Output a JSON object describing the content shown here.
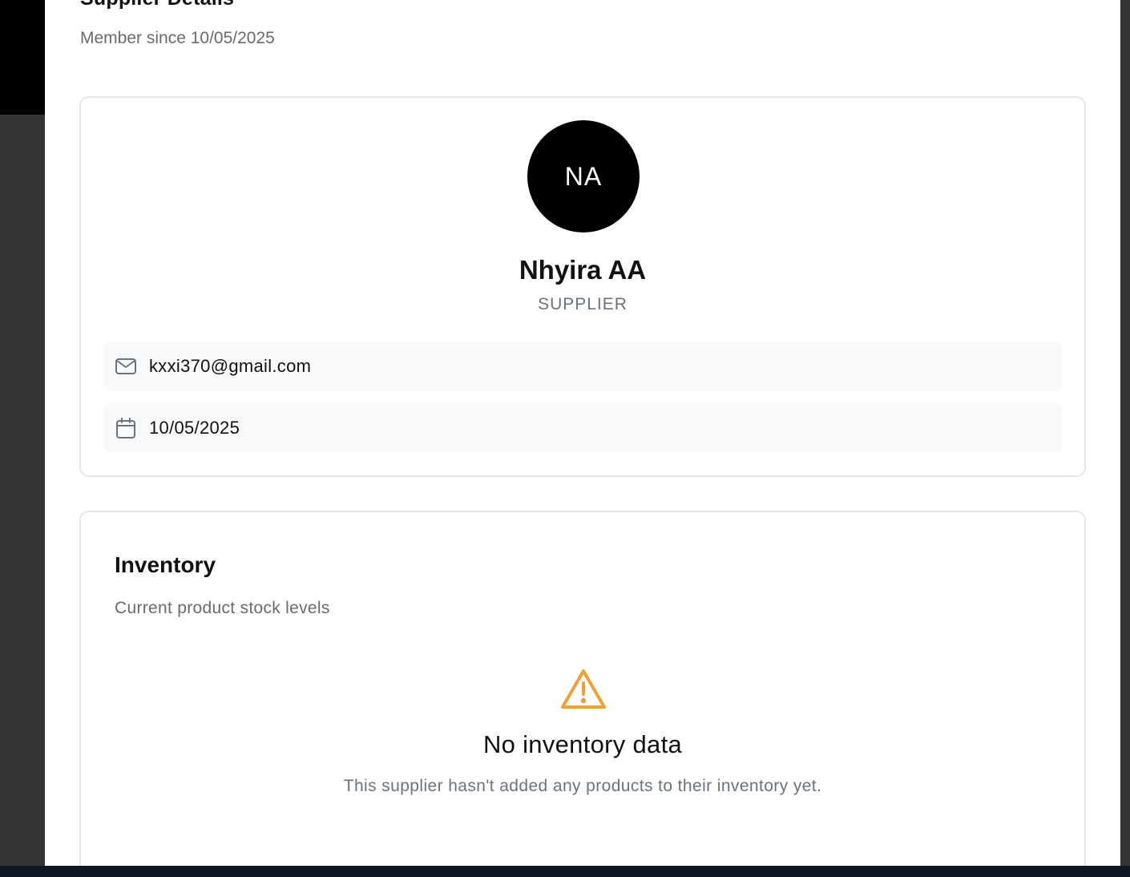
{
  "header": {
    "title": "Supplier Details",
    "subtitle": "Member since 10/05/2025"
  },
  "profile": {
    "initials": "NA",
    "name": "Nhyira AA",
    "role": "SUPPLIER",
    "email": "kxxi370@gmail.com",
    "date": "10/05/2025",
    "icons": {
      "email": "mail-icon",
      "date": "calendar-icon"
    }
  },
  "inventory": {
    "title": "Inventory",
    "subtitle": "Current product stock levels",
    "empty_icon": "warning-icon",
    "empty_title": "No inventory data",
    "empty_text": "This supplier hasn't added any products to their inventory yet."
  },
  "colors": {
    "avatar_bg": "#000000",
    "warning": "#f0a030",
    "muted_text": "#6b7280",
    "info_row_bg": "#f8f9fb"
  }
}
